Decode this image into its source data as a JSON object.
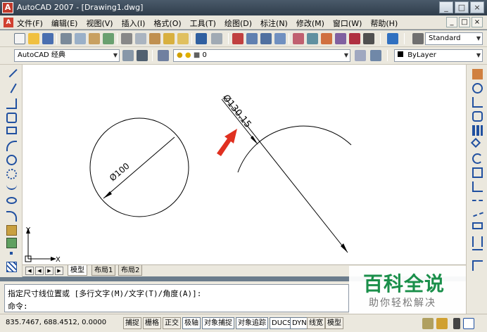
{
  "window": {
    "title": "AutoCAD 2007 - [Drawing1.dwg]",
    "app_icon_letter": "A",
    "controls": [
      "_",
      "□",
      "×"
    ]
  },
  "menubar": {
    "items": [
      "文件(F)",
      "编辑(E)",
      "视图(V)",
      "插入(I)",
      "格式(O)",
      "工具(T)",
      "绘图(D)",
      "标注(N)",
      "修改(M)",
      "窗口(W)",
      "帮助(H)"
    ],
    "doc_controls": [
      "_",
      "□",
      "×"
    ]
  },
  "toolbar": {
    "text_style": "Standard",
    "workspace": "AutoCAD 经典",
    "layer": "0",
    "color": "ByLayer"
  },
  "drawing": {
    "dim_small": "Ø100",
    "dim_large": "Ø130.15",
    "ucs_x": "X",
    "ucs_y": "Y",
    "colors": {
      "background": "#ffffff",
      "geometry": "#000000",
      "arrow": "#e03020"
    }
  },
  "layout_tabs": [
    "模型",
    "布局1",
    "布局2"
  ],
  "command": {
    "line1": "指定尺寸线位置或 [多行文字(M)/文字(T)/角度(A)]:",
    "line2": "命令:"
  },
  "status": {
    "coords": "835.7467, 688.4512, 0.0000",
    "buttons": [
      "捕捉",
      "栅格",
      "正交",
      "极轴",
      "对象捕捉",
      "对象追踪",
      "DUCS",
      "DYN",
      "线宽",
      "模型"
    ]
  },
  "watermark": {
    "logo": "百科全说",
    "sub": "助你轻松解决"
  }
}
